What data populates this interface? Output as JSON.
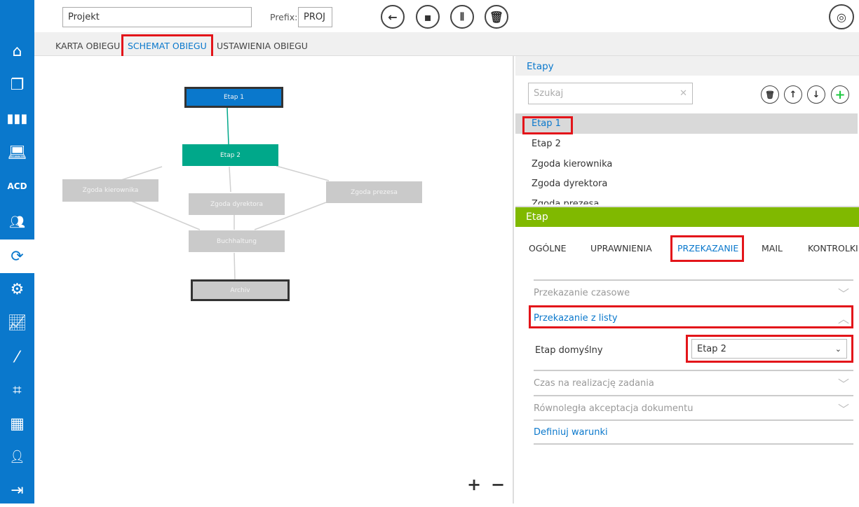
{
  "topbar": {
    "name_value": "Projekt",
    "prefix_label": "Prefix:",
    "prefix_value": "PROJ"
  },
  "tabs": [
    {
      "label": "KARTA OBIEGU"
    },
    {
      "label": "SCHEMAT OBIEGU"
    },
    {
      "label": "USTAWIENIA OBIEGU"
    }
  ],
  "diagram": {
    "nodes": [
      "Etap 1",
      "Etap 2",
      "Zgoda kierownika",
      "Zgoda dyrektora",
      "Zgoda prezesa",
      "Buchhaltung",
      "Archiv"
    ],
    "zoom_in": "+",
    "zoom_out": "−"
  },
  "etapy": {
    "title": "Etapy",
    "search_placeholder": "Szukaj",
    "items": [
      "Etap 1",
      "Etap 2",
      "Zgoda kierownika",
      "Zgoda dyrektora",
      "Zgoda prezesa"
    ]
  },
  "etap": {
    "title": "Etap",
    "tabs": [
      "OGÓLNE",
      "UPRAWNIENIA",
      "PRZEKAZANIE",
      "MAIL",
      "KONTROLKI"
    ],
    "sections": {
      "czasowe": "Przekazanie czasowe",
      "z_listy": "Przekazanie z listy",
      "default_label": "Etap domyślny",
      "default_value": "Etap 2",
      "czas": "Czas na realizację zadania",
      "rownolegla": "Równoległa akceptacja dokumentu",
      "warunki": "Definiuj warunki"
    }
  },
  "sidebar": {
    "icons": [
      "home-icon",
      "documents-icon",
      "binders-icon",
      "laptop-icon",
      "acd-icon",
      "users-icon",
      "workflow-icon",
      "gear-icon",
      "chart-icon",
      "wand-icon",
      "template-icon",
      "calendar-icon",
      "user-settings-icon",
      "exit-icon"
    ],
    "acd_text": "ACD"
  },
  "colors": {
    "sidebar": "#0a78cc",
    "accent": "#0a78cc",
    "green_header": "#80b900",
    "teal": "#00a88a",
    "highlight": "#e3151a"
  }
}
